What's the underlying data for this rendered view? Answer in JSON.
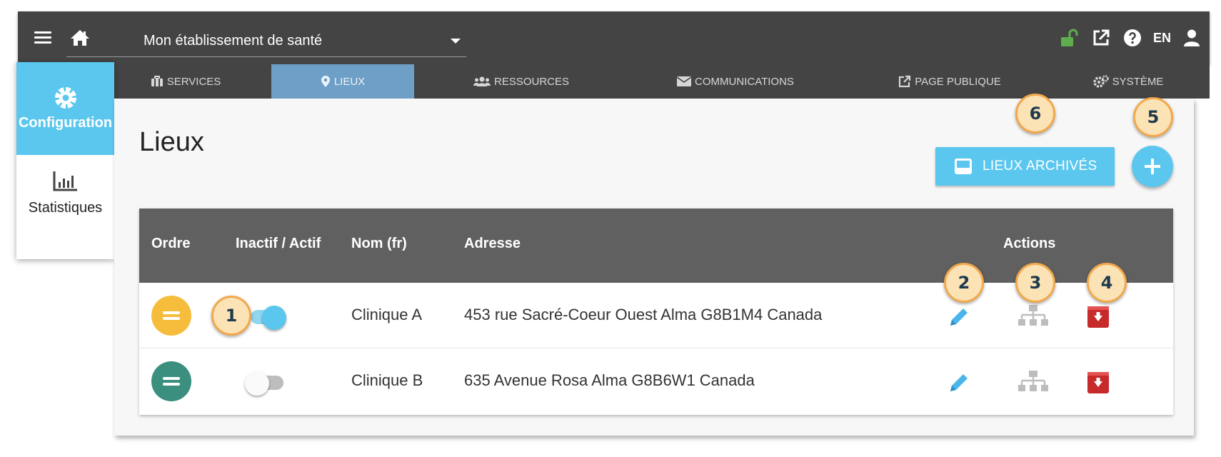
{
  "header": {
    "establishment": "Mon établissement de santé",
    "language": "EN",
    "icons": [
      "menu-icon",
      "home-icon",
      "unlock-icon",
      "external-link-icon",
      "help-icon",
      "user-icon"
    ],
    "lock_color": "#5fae4d"
  },
  "tabs": [
    {
      "label": "SERVICES",
      "icon": "briefcase-icon",
      "active": false
    },
    {
      "label": "LIEUX",
      "icon": "map-marker-icon",
      "active": true
    },
    {
      "label": "RESSOURCES",
      "icon": "users-icon",
      "active": false
    },
    {
      "label": "COMMUNICATIONS",
      "icon": "envelope-icon",
      "active": false
    },
    {
      "label": "PAGE PUBLIQUE",
      "icon": "external-link-icon",
      "active": false
    },
    {
      "label": "SYSTÈME",
      "icon": "cogs-icon",
      "active": false
    }
  ],
  "sidebar": {
    "items": [
      {
        "label": "Configuration",
        "icon": "gear-icon",
        "active": true
      },
      {
        "label": "Statistiques",
        "icon": "bar-chart-icon",
        "active": false
      }
    ]
  },
  "page": {
    "title": "Lieux",
    "archived_button": "LIEUX ARCHIVÉS",
    "add_button_icon": "plus-icon"
  },
  "table": {
    "headers": {
      "order": "Ordre",
      "active": "Inactif / Actif",
      "name": "Nom (fr)",
      "address": "Adresse",
      "actions": "Actions"
    },
    "rows": [
      {
        "order_color": "#f6bd3d",
        "active": true,
        "name": "Clinique A",
        "address": "453 rue Sacré-Coeur Ouest Alma G8B1M4 Canada"
      },
      {
        "order_color": "#3a8f7f",
        "active": false,
        "name": "Clinique B",
        "address": "635 Avenue Rosa Alma G8B6W1 Canada"
      }
    ],
    "action_icons": [
      "pencil-icon",
      "sitemap-icon",
      "archive-icon"
    ]
  },
  "callouts": {
    "c1": "1",
    "c2": "2",
    "c3": "3",
    "c4": "4",
    "c5": "5",
    "c6": "6"
  },
  "colors": {
    "accent": "#5bc7ee",
    "header_bg": "#444444",
    "tab_active": "#6e9fc6",
    "edit_icon": "#4ab5ea",
    "archive_icon": "#c62a2a",
    "callout_fill": "#fbe3b6",
    "callout_border": "#f2a84b"
  }
}
